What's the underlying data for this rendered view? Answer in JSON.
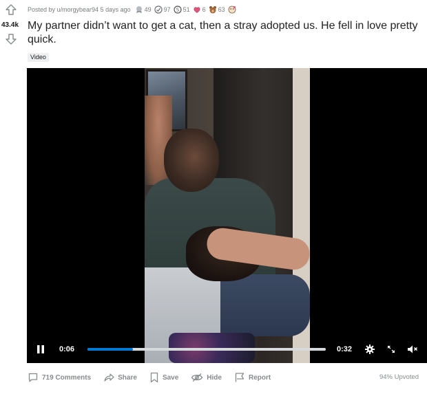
{
  "post": {
    "score": "43.4k",
    "posted_by": "Posted by u/morgybear94 5 days ago",
    "title": "My partner didn’t want to get a cat, then a stray adopted us. He fell in love pretty quick.",
    "flair": "Video",
    "awards": [
      {
        "icon": "silver-award-icon",
        "count": "49"
      },
      {
        "icon": "helpful-award-icon",
        "count": "97"
      },
      {
        "icon": "gold-coin-award-icon",
        "count": "51"
      },
      {
        "icon": "heart-award-icon",
        "count": "6"
      },
      {
        "icon": "bear-award-icon",
        "count": "63"
      },
      {
        "icon": "wholesome-award-icon",
        "count": ""
      }
    ]
  },
  "player": {
    "current_time": "0:06",
    "duration": "0:32",
    "progress": 0.19,
    "state": "playing",
    "muted": true
  },
  "actions": {
    "comments": "719 Comments",
    "share": "Share",
    "save": "Save",
    "hide": "Hide",
    "report": "Report"
  },
  "upvoted": "94% Upvoted",
  "colors": {
    "accent": "#0079d3",
    "muted_text": "#878a8c"
  }
}
